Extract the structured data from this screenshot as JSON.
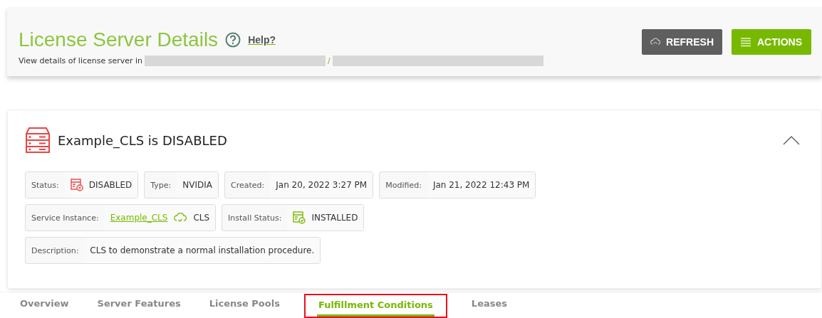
{
  "header": {
    "title": "License Server Details",
    "help": "Help?",
    "subtitle": "View details of license server in",
    "separator": "/",
    "redacted": true
  },
  "buttons": [
    {
      "kind": "refresh",
      "label": "REFRESH"
    },
    {
      "kind": "actions",
      "label": "ACTIONS"
    }
  ],
  "server": {
    "name": "Example_CLS is DISABLED",
    "expanded": true
  },
  "field_rows": [
    [
      {
        "kind": "status",
        "label": "Status:",
        "value": "DISABLED",
        "ok": false
      },
      {
        "kind": "text",
        "label": "Type:",
        "value": "NVIDIA"
      },
      {
        "kind": "text",
        "label": "Created:",
        "value": "Jan 20, 2022 3:27 PM"
      },
      {
        "kind": "text",
        "label": "Modified:",
        "value": "Jan 21, 2022 12:43 PM"
      }
    ],
    [
      {
        "kind": "link",
        "label": "Service Instance:",
        "value": "Example_CLS",
        "suffix": "CLS"
      },
      {
        "kind": "status",
        "label": "Install Status:",
        "value": "INSTALLED",
        "ok": true
      }
    ],
    [
      {
        "kind": "text",
        "label": "Description:",
        "value": "CLS to demonstrate a normal installation procedure."
      }
    ]
  ],
  "tabs": [
    {
      "label": "Overview",
      "selected": false,
      "highlighted": false
    },
    {
      "label": "Server Features",
      "selected": false,
      "highlighted": false
    },
    {
      "label": "License Pools",
      "selected": false,
      "highlighted": false
    },
    {
      "label": "Fulfillment Conditions",
      "selected": true,
      "highlighted": true
    },
    {
      "label": "Leases",
      "selected": false,
      "highlighted": false
    }
  ]
}
